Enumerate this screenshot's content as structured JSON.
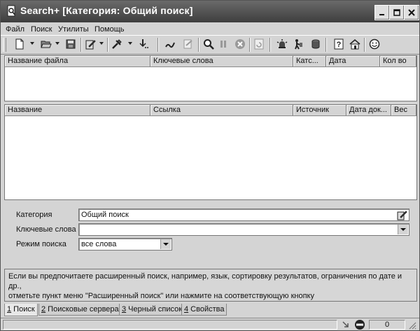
{
  "window": {
    "title": "Search+ [Категория: Общий поиск]"
  },
  "menu": [
    "Файл",
    "Поиск",
    "Утилиты",
    "Помощь"
  ],
  "toolbar": {
    "icons": [
      "new-doc-icon",
      "open-folder-icon",
      "save-icon",
      "clipboard-edit-icon",
      "tools-icon",
      "import-icon",
      "wand-icon",
      "edit-doc-icon",
      "magnifier-icon",
      "pause-icon",
      "stop-icon",
      "refresh-icon",
      "alarm-icon",
      "walking-person-icon",
      "database-icon",
      "help-icon",
      "home-icon",
      "smiley-icon"
    ]
  },
  "files_table": {
    "columns": [
      "Название файла",
      "Ключевые слова",
      "Катс...",
      "Дата",
      "Кол во"
    ]
  },
  "results_table": {
    "columns": [
      "Название",
      "Ссылка",
      "Источник",
      "Дата док...",
      "Вес"
    ]
  },
  "form": {
    "category_label": "Категория",
    "category_value": "Общий поиск",
    "keywords_label": "Ключевые слова",
    "keywords_value": "",
    "mode_label": "Режим поиска",
    "mode_value": "все слова"
  },
  "hint": {
    "line1": "Если вы предпочитаете расширенный поиск, например, язык, сортировку результатов, ограничения по дате и др.,",
    "line2": "отметьте пункт меню \"Расширенный поиск\" или нажмите на соответствующую кнопку"
  },
  "tabs": [
    {
      "num": "1",
      "label": " Поиск"
    },
    {
      "num": "2",
      "label": " Поисковые сервера"
    },
    {
      "num": "3",
      "label": " Черный список"
    },
    {
      "num": "4",
      "label": " Свойства"
    }
  ],
  "status": {
    "count": "0"
  }
}
